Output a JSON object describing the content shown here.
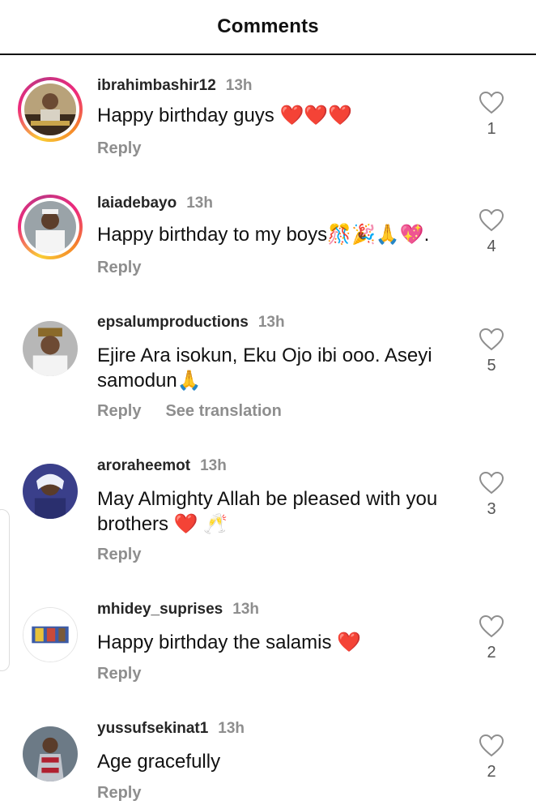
{
  "header": {
    "title": "Comments"
  },
  "comments": [
    {
      "username": "ibrahimbashir12",
      "time": "13h",
      "text": "Happy birthday guys ❤️❤️❤️",
      "reply": "Reply",
      "likes": "1",
      "avatar_icon": "avatar-story-ring"
    },
    {
      "username": "laiadebayo",
      "time": "13h",
      "text": "Happy birthday to my boys🎊🎉🙏💖.",
      "reply": "Reply",
      "likes": "4",
      "avatar_icon": "avatar-story-ring"
    },
    {
      "username": "epsalumproductions",
      "time": "13h",
      "text": "Ejire Ara isokun, Eku Ojo ibi ooo. Aseyi samodun🙏",
      "reply": "Reply",
      "see_translation": "See translation",
      "likes": "5",
      "avatar_icon": "avatar"
    },
    {
      "username": "aroraheemot",
      "time": "13h",
      "text": "May Almighty Allah be pleased with you brothers ❤️ 🥂",
      "reply": "Reply",
      "likes": "3",
      "avatar_icon": "avatar"
    },
    {
      "username": "mhidey_suprises",
      "time": "13h",
      "text": "Happy birthday the salamis ❤️",
      "reply": "Reply",
      "likes": "2",
      "avatar_icon": "avatar"
    },
    {
      "username": "yussufsekinat1",
      "time": "13h",
      "text": "Age gracefully",
      "reply": "Reply",
      "likes": "2",
      "avatar_icon": "avatar"
    }
  ],
  "colors": {
    "accent_red": "#e0102c",
    "muted": "#8e8e8e"
  }
}
